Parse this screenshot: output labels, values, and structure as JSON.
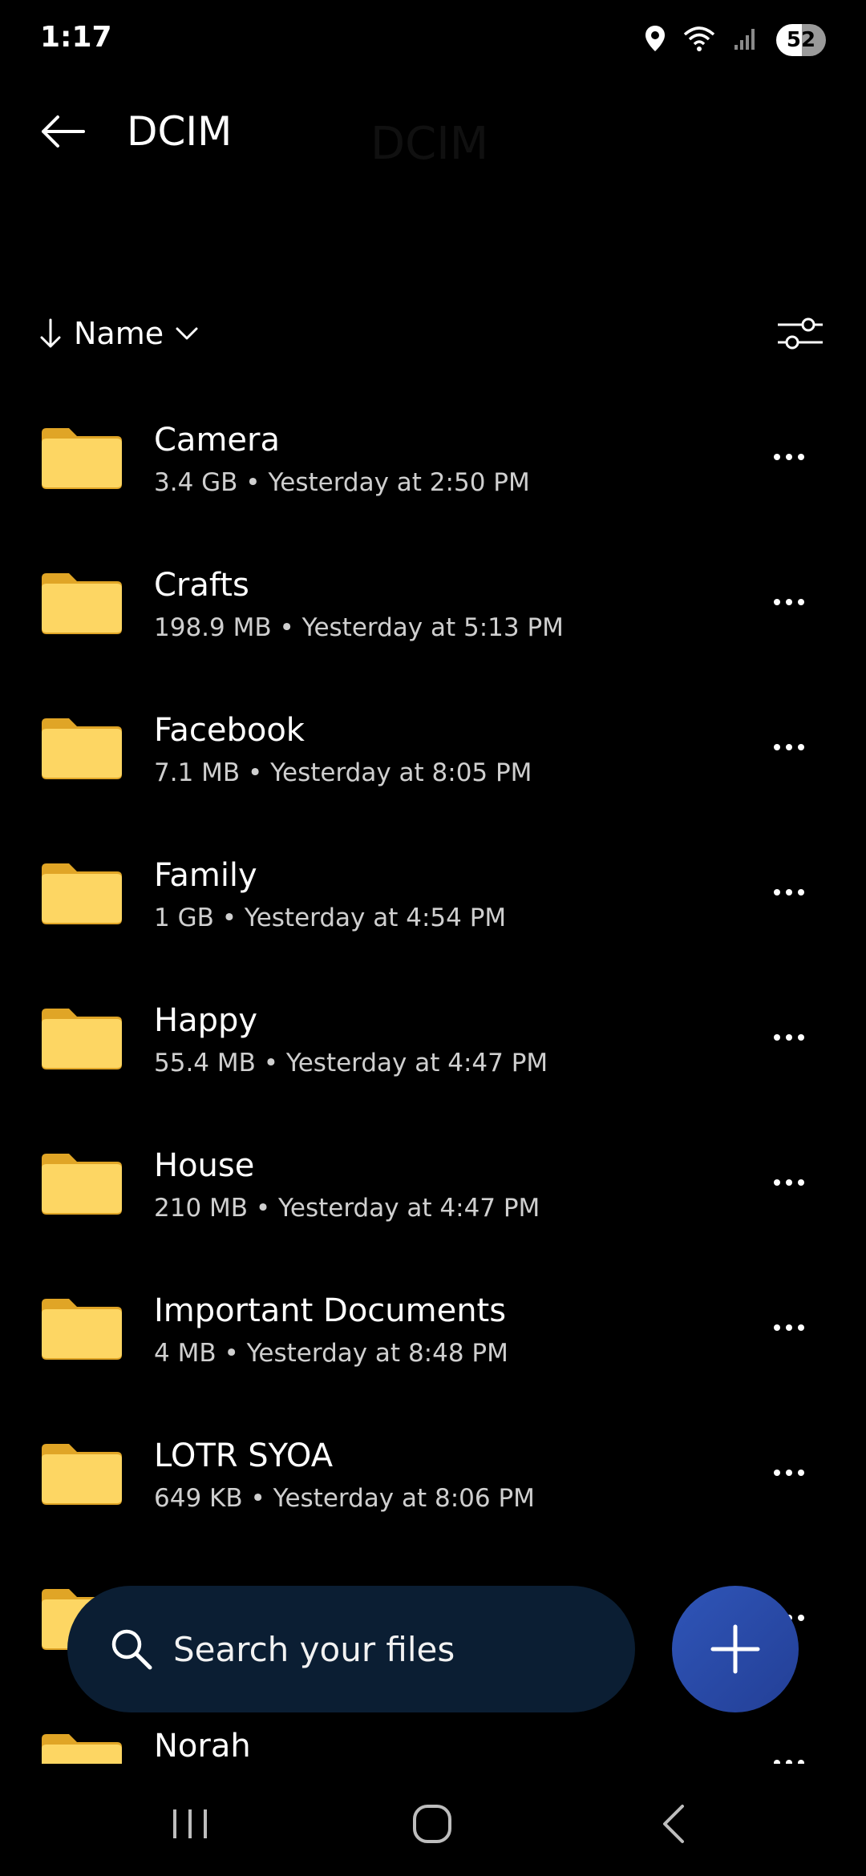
{
  "status_bar": {
    "time": "1:17",
    "battery": "52"
  },
  "header": {
    "title": "DCIM",
    "ghost_title": "DCIM"
  },
  "sort": {
    "label": "Name"
  },
  "folders": [
    {
      "name": "Camera",
      "size": "3.4 GB",
      "modified": "Yesterday at 2:50 PM"
    },
    {
      "name": "Crafts",
      "size": "198.9 MB",
      "modified": "Yesterday at 5:13 PM"
    },
    {
      "name": "Facebook",
      "size": "7.1 MB",
      "modified": "Yesterday at 8:05 PM"
    },
    {
      "name": "Family",
      "size": "1 GB",
      "modified": "Yesterday at 4:54 PM"
    },
    {
      "name": "Happy",
      "size": "55.4 MB",
      "modified": "Yesterday at 4:47 PM"
    },
    {
      "name": "House",
      "size": "210 MB",
      "modified": "Yesterday at 4:47 PM"
    },
    {
      "name": "Important Documents",
      "size": "4 MB",
      "modified": "Yesterday at 8:48 PM"
    },
    {
      "name": "LOTR SYOA",
      "size": "649 KB",
      "modified": "Yesterday at 8:06 PM"
    },
    {
      "name": "",
      "size": "",
      "modified": ""
    },
    {
      "name": "Norah",
      "size": "",
      "modified": ""
    }
  ],
  "meta_separator": " • ",
  "search": {
    "placeholder": "Search your files"
  },
  "colors": {
    "background": "#000000",
    "folder": "#fdd663",
    "folder_tab": "#f9c84a",
    "folder_edge": "#e0a526",
    "search_bar": "#0b1e33",
    "fab": "#2f55b8"
  }
}
